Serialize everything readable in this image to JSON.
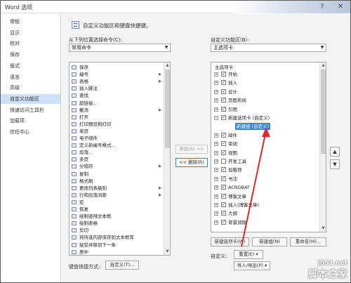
{
  "window": {
    "title": "Word 选项",
    "help_glyph": "?",
    "close_glyph": "✕"
  },
  "sidebar": {
    "items": [
      "常规",
      "显示",
      "校对",
      "保存",
      "版式",
      "语言",
      "高级",
      "自定义功能区",
      "快速访问工具栏",
      "加载项",
      "信任中心"
    ],
    "active_index": 7
  },
  "header": {
    "text": "自定义功能区和键盘快捷键。"
  },
  "left": {
    "choose_label": "从下列位置选择命令(C):",
    "choose_value": "常用命令",
    "commands": [
      {
        "label": "保存",
        "sub": ""
      },
      {
        "label": "编号",
        "sub": "▶"
      },
      {
        "label": "表格",
        "sub": "▶"
      },
      {
        "label": "插入脚注",
        "sub": ""
      },
      {
        "label": "查找",
        "sub": ""
      },
      {
        "label": "超链接...",
        "sub": ""
      },
      {
        "label": "撤消",
        "sub": "▶"
      },
      {
        "label": "打开",
        "sub": ""
      },
      {
        "label": "打印预览和打印",
        "sub": ""
      },
      {
        "label": "单页",
        "sub": ""
      },
      {
        "label": "电子邮件",
        "sub": ""
      },
      {
        "label": "定义新编号格式...",
        "sub": ""
      },
      {
        "label": "段落...",
        "sub": ""
      },
      {
        "label": "多页",
        "sub": ""
      },
      {
        "label": "分隔符",
        "sub": "▶"
      },
      {
        "label": "复制",
        "sub": ""
      },
      {
        "label": "格式刷",
        "sub": ""
      },
      {
        "label": "更改列表级别",
        "sub": "▶"
      },
      {
        "label": "行和段落间距",
        "sub": "▶"
      },
      {
        "label": "宏",
        "sub": ""
      },
      {
        "label": "恢复",
        "sub": ""
      },
      {
        "label": "绘制竖排文本框",
        "sub": ""
      },
      {
        "label": "绘制表格",
        "sub": ""
      },
      {
        "label": "剪切",
        "sub": ""
      },
      {
        "label": "将所选内容保存到文本框库",
        "sub": ""
      },
      {
        "label": "接受并移到下一条",
        "sub": ""
      },
      {
        "label": "居中",
        "sub": ""
      }
    ],
    "keyboard_label": "键盘快捷方式:",
    "customize_button": "自定义(T)..."
  },
  "middle": {
    "add_button": "添加(A) >>",
    "remove_button": "<< 删除(R)"
  },
  "right": {
    "custom_label": "自定义功能区(B):",
    "custom_value": "主选项卡",
    "tree_header": "主选项卡",
    "tree": [
      {
        "label": "开始",
        "checked": true,
        "indent": 1,
        "exp": "+",
        "selected": false
      },
      {
        "label": "插入",
        "checked": true,
        "indent": 1,
        "exp": "+",
        "selected": false
      },
      {
        "label": "设计",
        "checked": true,
        "indent": 1,
        "exp": "+",
        "selected": false
      },
      {
        "label": "页面布局",
        "checked": true,
        "indent": 1,
        "exp": "+",
        "selected": false
      },
      {
        "label": "引用",
        "checked": true,
        "indent": 1,
        "exp": "+",
        "selected": false
      },
      {
        "label": "新建选项卡 (自定义)",
        "checked": true,
        "indent": 1,
        "exp": "−",
        "selected": false
      },
      {
        "label": "新建组 (自定义)",
        "checked": null,
        "indent": 2,
        "exp": "",
        "selected": true
      },
      {
        "label": "邮件",
        "checked": true,
        "indent": 1,
        "exp": "+",
        "selected": false
      },
      {
        "label": "审阅",
        "checked": true,
        "indent": 1,
        "exp": "+",
        "selected": false
      },
      {
        "label": "视图",
        "checked": true,
        "indent": 1,
        "exp": "+",
        "selected": false
      },
      {
        "label": "开发工具",
        "checked": false,
        "indent": 1,
        "exp": "+",
        "selected": false
      },
      {
        "label": "加载项",
        "checked": true,
        "indent": 1,
        "exp": "+",
        "selected": false
      },
      {
        "label": "书法",
        "checked": true,
        "indent": 1,
        "exp": "+",
        "selected": false
      },
      {
        "label": "ACROBAT",
        "checked": true,
        "indent": 1,
        "exp": "+",
        "selected": false
      },
      {
        "label": "博客文章",
        "checked": true,
        "indent": 1,
        "exp": "+",
        "selected": false
      },
      {
        "label": "插入(博客文章)",
        "checked": true,
        "indent": 1,
        "exp": "+",
        "selected": false
      },
      {
        "label": "大纲",
        "checked": true,
        "indent": 1,
        "exp": "+",
        "selected": false
      },
      {
        "label": "背景消除",
        "checked": true,
        "indent": 1,
        "exp": "+",
        "selected": false
      }
    ],
    "new_tab_button": "新建选项卡(W)",
    "new_group_button": "新建组(N)",
    "rename_button": "重命名(M)...",
    "customize_label": "自定义:",
    "reset_button": "重置(E) ▾",
    "import_export_button": "导入/导出(P) ▾",
    "move_up_glyph": "▲",
    "move_down_glyph": "▼"
  },
  "annotation": {
    "color": "#e0262b"
  },
  "watermark": {
    "line1": "jb51.net",
    "line2": "脚本之家"
  }
}
